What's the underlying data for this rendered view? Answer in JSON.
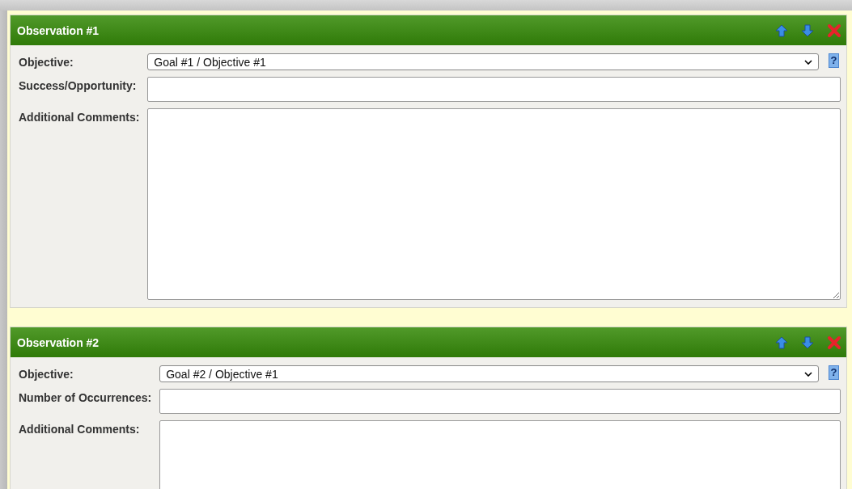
{
  "observations": [
    {
      "title": "Observation #1",
      "fields": [
        {
          "kind": "select",
          "label": "Objective:",
          "value": "Goal #1 / Objective #1",
          "help": "?"
        },
        {
          "kind": "text",
          "label": "Success/Opportunity:"
        },
        {
          "kind": "textarea",
          "label": "Additional Comments:"
        }
      ]
    },
    {
      "title": "Observation #2",
      "fields": [
        {
          "kind": "select",
          "label": "Objective:",
          "value": "Goal #2 / Objective #1",
          "help": "?"
        },
        {
          "kind": "text",
          "label": "Number of Occurrences:"
        },
        {
          "kind": "textarea",
          "label": "Additional Comments:"
        }
      ]
    }
  ]
}
